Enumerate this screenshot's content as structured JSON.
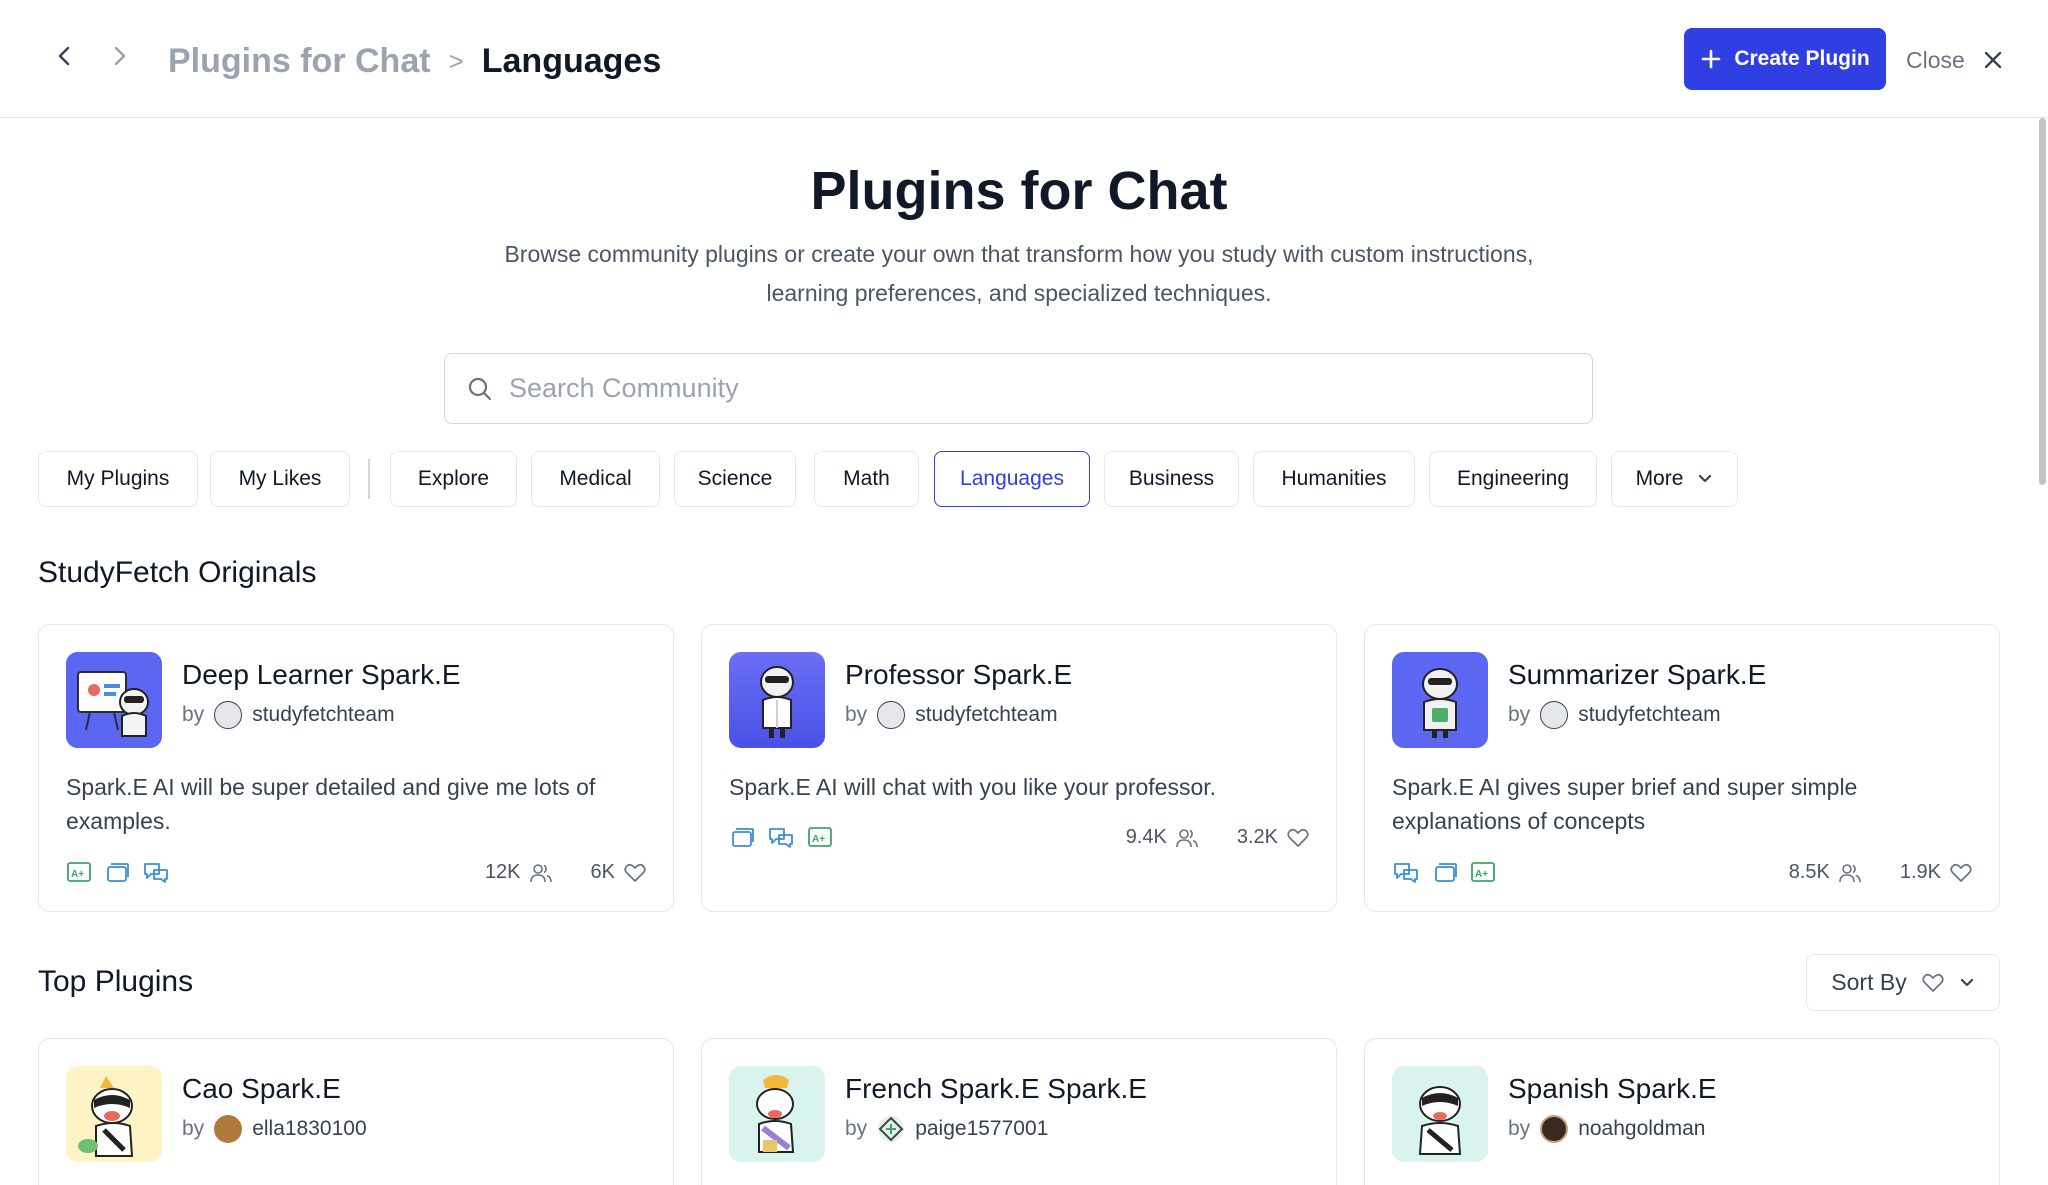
{
  "breadcrumb": {
    "parent": "Plugins for Chat",
    "separator": ">",
    "current": "Languages"
  },
  "header": {
    "create_label": "Create Plugin",
    "close_label": "Close"
  },
  "hero": {
    "title": "Plugins for Chat",
    "subtitle_line1": "Browse community plugins or create your own that transform how you study with custom instructions,",
    "subtitle_line2": "learning preferences, and specialized techniques."
  },
  "search": {
    "placeholder": "Search Community",
    "value": ""
  },
  "tabs": [
    "My Plugins",
    "My Likes",
    "Explore",
    "Medical",
    "Science",
    "Math",
    "Languages",
    "Business",
    "Humanities",
    "Engineering",
    "More"
  ],
  "active_tab": "Languages",
  "sections": {
    "originals": "StudyFetch Originals",
    "top": "Top Plugins",
    "sort_label": "Sort By"
  },
  "originals": [
    {
      "name": "Deep Learner Spark.E",
      "by": "by",
      "author": "studyfetchteam",
      "description": "Spark.E AI will be super detailed and give me lots of examples.",
      "features": [
        "grade-icon",
        "cards-icon",
        "chat-icon"
      ],
      "users": "12K",
      "likes": "6K"
    },
    {
      "name": "Professor Spark.E",
      "by": "by",
      "author": "studyfetchteam",
      "description": "Spark.E AI will chat with you like your professor.",
      "features": [
        "cards-icon",
        "chat-icon",
        "grade-icon"
      ],
      "users": "9.4K",
      "likes": "3.2K"
    },
    {
      "name": "Summarizer Spark.E",
      "by": "by",
      "author": "studyfetchteam",
      "description": "Spark.E AI gives super brief and super simple explanations of concepts",
      "features": [
        "chat-icon",
        "cards-icon",
        "grade-icon"
      ],
      "users": "8.5K",
      "likes": "1.9K"
    }
  ],
  "top_plugins": [
    {
      "name": "Cao Spark.E",
      "by": "by",
      "author": "ella1830100"
    },
    {
      "name": "French Spark.E Spark.E",
      "by": "by",
      "author": "paige1577001"
    },
    {
      "name": "Spanish Spark.E",
      "by": "by",
      "author": "noahgoldman"
    }
  ],
  "colors": {
    "accent": "#2f3fe3",
    "tile_purple": "#5b5ff0",
    "tile_yellow": "#fdf3c4",
    "tile_mint": "#d9f4ee",
    "feature_green": "#3aa66a",
    "feature_blue": "#3a8fd6"
  }
}
